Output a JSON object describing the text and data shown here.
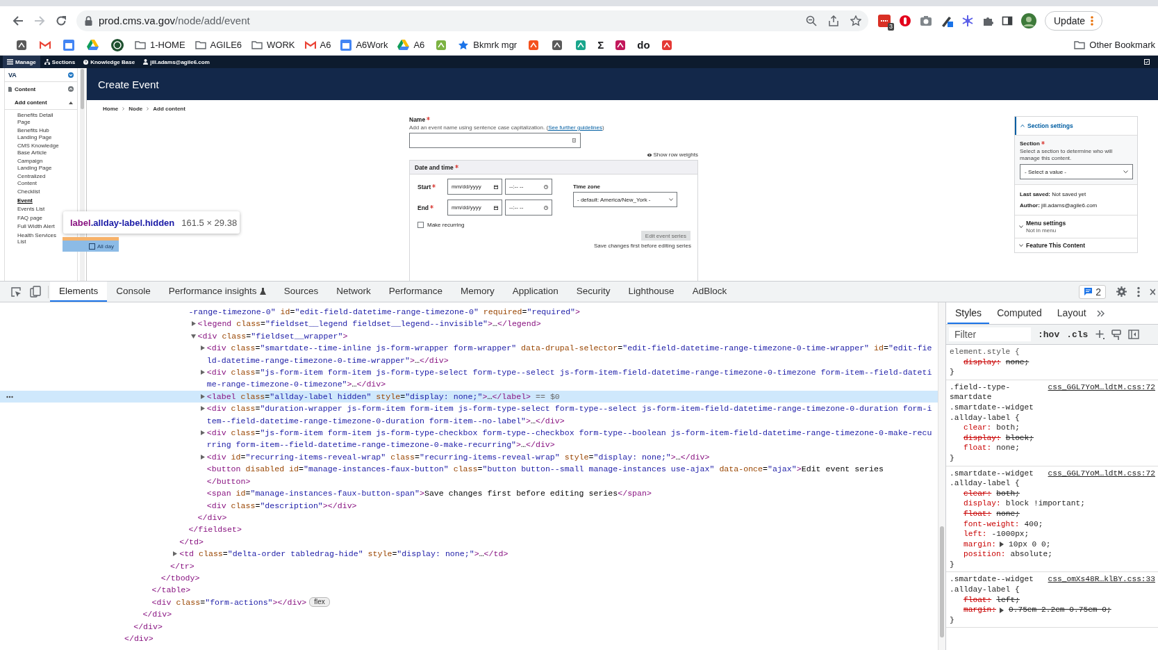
{
  "browser": {
    "url_host": "prod.cms.va.gov",
    "url_path": "/node/add/event",
    "extension_badge": "3",
    "update_button": "Update",
    "bookmarks": [
      {
        "kind": "app"
      },
      {
        "kind": "gmail"
      },
      {
        "kind": "calendar"
      },
      {
        "kind": "drive"
      },
      {
        "kind": "badge"
      },
      {
        "kind": "folder",
        "label": "1-HOME"
      },
      {
        "kind": "folder",
        "label": "AGILE6"
      },
      {
        "kind": "folder",
        "label": "WORK"
      },
      {
        "kind": "gmail",
        "label": "A6"
      },
      {
        "kind": "calendar",
        "label": "A6Work"
      },
      {
        "kind": "drive",
        "label": "A6"
      },
      {
        "kind": "app"
      },
      {
        "kind": "star",
        "label": "Bkmrk mgr"
      },
      {
        "kind": "app"
      },
      {
        "kind": "app"
      },
      {
        "kind": "app"
      },
      {
        "kind": "glyph",
        "label": "Σ"
      },
      {
        "kind": "app"
      },
      {
        "kind": "glyph",
        "label": "do"
      },
      {
        "kind": "app"
      }
    ],
    "other_bookmarks": "Other Bookmark"
  },
  "cms": {
    "toolbar": [
      {
        "kind": "menu",
        "label": "Manage",
        "selected": true
      },
      {
        "kind": "sections",
        "label": "Sections",
        "selected": false
      },
      {
        "kind": "help",
        "label": "Knowledge Base",
        "selected": false
      },
      {
        "kind": "user",
        "label": "jill.adams@agile6.com",
        "selected": false
      }
    ],
    "sidebar": {
      "title": "VA",
      "section": {
        "label": "Content",
        "expanded": true
      },
      "subsection": {
        "label": "Add content",
        "expanded": true
      },
      "items": [
        {
          "label": "Benefits Detail Page",
          "selected": false
        },
        {
          "label": "Benefits Hub Landing Page",
          "selected": false
        },
        {
          "label": "CMS Knowledge Base Article",
          "selected": false
        },
        {
          "label": "Campaign Landing Page",
          "selected": false
        },
        {
          "label": "Centralized Content",
          "selected": false
        },
        {
          "label": "Checklist",
          "selected": false
        },
        {
          "label": "Event",
          "selected": true
        },
        {
          "label": "Events List",
          "selected": false
        },
        {
          "label": "FAQ page",
          "selected": false
        },
        {
          "label": "Full Width Alert",
          "selected": false
        },
        {
          "label": "Health Services List",
          "selected": false
        }
      ]
    },
    "page_title": "Create Event",
    "breadcrumb": [
      "Home",
      "Node",
      "Add content"
    ],
    "name_field": {
      "label": "Name",
      "required": true,
      "hint_before": "Add an event name using sentence case capitalization. (",
      "hint_link": "See further guidelines",
      "hint_after": ")"
    },
    "show_row_weights": "Show row weights",
    "datetime": {
      "legend": "Date and time",
      "required": true,
      "rows": [
        {
          "label": "Start",
          "required": true,
          "date": "mm/dd/yyyy",
          "time": "--:-- --"
        },
        {
          "label": "End",
          "required": true,
          "date": "mm/dd/yyyy",
          "time": "--:-- --"
        }
      ],
      "timezone": {
        "label": "Time zone",
        "value": "- default: America/New_York -"
      },
      "make_recurring": {
        "label": "Make recurring",
        "checked": false
      },
      "edit_series_button": {
        "label": "Edit event series",
        "disabled": true
      },
      "save_note": "Save changes first before editing series"
    },
    "right_panel": {
      "section_settings": {
        "title": "Section settings",
        "expanded": true,
        "field_label": "Section",
        "required": true,
        "hint": "Select a section to determine who will manage this content.",
        "select": "- Select a value -"
      },
      "last_saved_label": "Last saved:",
      "last_saved": "Not saved yet",
      "author_label": "Author:",
      "author": "jill.adams@agile6.com",
      "menu_settings": {
        "title": "Menu settings",
        "subtitle": "Not in menu",
        "expanded": false
      },
      "feature": {
        "title": "Feature This Content",
        "expanded": false
      }
    },
    "inspector_tooltip": {
      "tag": "label",
      "classes": ".allday-label.hidden",
      "size": "161.5 × 29.38"
    },
    "highlighted_element": {
      "label": "All day",
      "checked": false
    }
  },
  "devtools": {
    "tabs": [
      {
        "label": "Elements",
        "selected": true,
        "kind": "plain"
      },
      {
        "label": "Console",
        "selected": false,
        "kind": "plain"
      },
      {
        "label": "Performance insights",
        "selected": false,
        "kind": "experimental"
      },
      {
        "label": "Sources",
        "selected": false,
        "kind": "plain"
      },
      {
        "label": "Network",
        "selected": false,
        "kind": "plain"
      },
      {
        "label": "Performance",
        "selected": false,
        "kind": "plain"
      },
      {
        "label": "Memory",
        "selected": false,
        "kind": "plain"
      },
      {
        "label": "Application",
        "selected": false,
        "kind": "plain"
      },
      {
        "label": "Security",
        "selected": false,
        "kind": "plain"
      },
      {
        "label": "Lighthouse",
        "selected": false,
        "kind": "plain"
      },
      {
        "label": "AdBlock",
        "selected": false,
        "kind": "plain"
      }
    ],
    "issues_count": "2",
    "dom_tree": [
      {
        "children": [
          {
            "children": [
              {
                "children": [
                  {
                    "children": [
                      {
                        "children": [
                          {
                            "children": [
                              {
                                "children": [
                                  {
                                    "text": "-range-timezone-0\" id=\"edit-field-datetime-range-timezone-0\" required=\"required\">",
                                    "starts_in_value": true,
                                    "selected": false,
                                    "children": [
                                      {
                                        "text": "<legend class=\"fieldset__legend fieldset__legend--invisible\">…</legend>",
                                        "expanded": false,
                                        "selected": false
                                      },
                                      {
                                        "text": "<div class=\"fieldset__wrapper\">",
                                        "expanded": true,
                                        "selected": false,
                                        "children": [
                                          {
                                            "text": "<div class=\"smartdate--time-inline js-form-wrapper form-wrapper\" data-drupal-selector=\"edit-field-datetime-range-timezone-0-time-wrapper\" id=\"edit-field-datetime-range-timezone-0-time-wrapper\">…</div>",
                                            "expanded": false,
                                            "selected": false
                                          },
                                          {
                                            "text": "<div class=\"js-form-item form-item js-form-type-select form-type--select js-form-item-field-datetime-range-timezone-0-timezone form-item--field-datetime-range-timezone-0-timezone\">…</div>",
                                            "expanded": false,
                                            "selected": false
                                          },
                                          {
                                            "text": "<label class=\"allday-label hidden\" style=\"display: none;\">…</label>",
                                            "expanded": false,
                                            "selected": true,
                                            "suffix": "== $0"
                                          },
                                          {
                                            "text": "<div class=\"duration-wrapper js-form-item form-item js-form-type-select form-type--select js-form-item-field-datetime-range-timezone-0-duration form-item--field-datetime-range-timezone-0-duration form-item--no-label\">…</div>",
                                            "expanded": false,
                                            "selected": false
                                          },
                                          {
                                            "text": "<div class=\"js-form-item form-item js-form-type-checkbox form-type--checkbox form-type--boolean js-form-item-field-datetime-range-timezone-0-make-recurring form-item--field-datetime-range-timezone-0-make-recurring\">…</div>",
                                            "expanded": false,
                                            "selected": false
                                          },
                                          {
                                            "text": "<div id=\"recurring-items-reveal-wrap\" class=\"recurring-items-reveal-wrap\" style=\"display: none;\">…</div>",
                                            "expanded": false,
                                            "selected": false
                                          },
                                          {
                                            "text": "<button disabled id=\"manage-instances-faux-button\" class=\"button button--small manage-instances use-ajax\" data-once=\"ajax\">Edit event series",
                                            "selected": false
                                          },
                                          {
                                            "text": "</button>",
                                            "selected": false
                                          },
                                          {
                                            "text": "<span id=\"manage-instances-faux-button-span\">Save changes first before editing series</span>",
                                            "selected": false
                                          },
                                          {
                                            "text": "<div class=\"description\"></div>",
                                            "selected": false
                                          }
                                        ]
                                      },
                                      {
                                        "text": "</div>",
                                        "selected": false
                                      }
                                    ]
                                  },
                                  {
                                    "text": "</fieldset>",
                                    "selected": false
                                  }
                                ]
                              },
                              {
                                "text": "</td>",
                                "selected": false
                              },
                              {
                                "text": "<td class=\"delta-order tabledrag-hide\" style=\"display: none;\">…</td>",
                                "expanded": false,
                                "selected": false
                              }
                            ]
                          },
                          {
                            "text": "</tr>",
                            "selected": false
                          }
                        ]
                      },
                      {
                        "text": "</tbody>",
                        "selected": false
                      }
                    ]
                  },
                  {
                    "text": "</table>",
                    "selected": false
                  },
                  {
                    "text": "<div class=\"form-actions\"></div>",
                    "badge": "flex",
                    "selected": false
                  }
                ]
              },
              {
                "text": "</div>",
                "selected": false
              }
            ]
          },
          {
            "text": "</div>",
            "selected": false
          }
        ]
      },
      {
        "text": "</div>",
        "selected": false
      }
    ],
    "styles": {
      "tabs": [
        {
          "label": "Styles",
          "selected": true
        },
        {
          "label": "Computed",
          "selected": false
        },
        {
          "label": "Layout",
          "selected": false
        }
      ],
      "filter_placeholder": "Filter",
      "hov": ":hov",
      "cls": ".cls",
      "rules": [
        {
          "kind": "inline",
          "selector": "element.style {",
          "declarations": [
            {
              "property": "display:",
              "value": "none;",
              "struck": true
            }
          ],
          "close": "}"
        },
        {
          "kind": "sheet",
          "selector": ".field--type-smartdate .smartdate--widget .allday-label {",
          "source": "css_GGL7YoM…ldtM.css:72",
          "declarations": [
            {
              "property": "clear:",
              "value": "both;",
              "struck": false
            },
            {
              "property": "display:",
              "value": "block;",
              "struck": true
            },
            {
              "property": "float:",
              "value": "none;",
              "struck": false
            }
          ],
          "close": "}"
        },
        {
          "kind": "sheet",
          "selector": ".smartdate--widget .allday-label {",
          "source": "css_GGL7YoM…ldtM.css:72",
          "declarations": [
            {
              "property": "clear:",
              "value": "both;",
              "struck": true
            },
            {
              "property": "display:",
              "value": "block !important;",
              "struck": false
            },
            {
              "property": "float:",
              "value": "none;",
              "struck": true
            },
            {
              "property": "font-weight:",
              "value": "400;",
              "struck": false
            },
            {
              "property": "left:",
              "value": "-1000px;",
              "struck": false
            },
            {
              "property": "margin:",
              "value": "10px 0 0;",
              "struck": false,
              "shorthand": true
            },
            {
              "property": "position:",
              "value": "absolute;",
              "struck": false
            }
          ],
          "close": "}"
        },
        {
          "kind": "sheet",
          "selector": ".smartdate--widget .allday-label {",
          "source": "css_omXs48R…klBY.css:33",
          "declarations": [
            {
              "property": "float:",
              "value": "left;",
              "struck": true
            },
            {
              "property": "margin:",
              "value": "0.75em 2.2em 0.75em 0;",
              "struck": true,
              "shorthand": true
            }
          ],
          "close": "}"
        }
      ]
    }
  }
}
